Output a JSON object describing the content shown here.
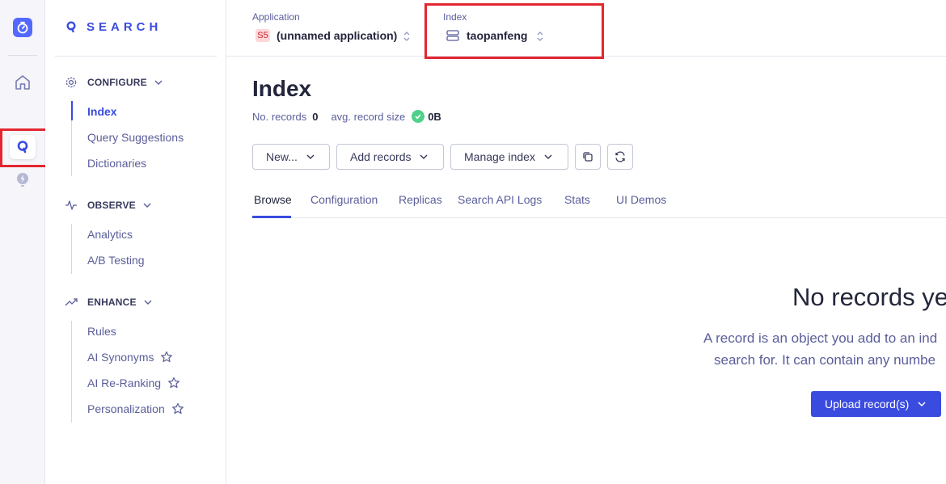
{
  "brand": {
    "name": "SEARCH"
  },
  "sidebar": {
    "sections": [
      {
        "label": "CONFIGURE",
        "items": [
          {
            "label": "Index",
            "active": true,
            "star": false
          },
          {
            "label": "Query Suggestions",
            "active": false,
            "star": false
          },
          {
            "label": "Dictionaries",
            "active": false,
            "star": false
          }
        ]
      },
      {
        "label": "OBSERVE",
        "items": [
          {
            "label": "Analytics",
            "star": false
          },
          {
            "label": "A/B Testing",
            "star": false
          }
        ]
      },
      {
        "label": "ENHANCE",
        "items": [
          {
            "label": "Rules",
            "star": false
          },
          {
            "label": "AI Synonyms",
            "star": true
          },
          {
            "label": "AI Re-Ranking",
            "star": true
          },
          {
            "label": "Personalization",
            "star": true
          }
        ]
      }
    ]
  },
  "topbar": {
    "application": {
      "label": "Application",
      "badge": "S5",
      "value": "(unnamed application)"
    },
    "index": {
      "label": "Index",
      "value": "taopanfeng"
    }
  },
  "page": {
    "title": "Index",
    "records_label": "No. records",
    "records_value": "0",
    "avg_label": "avg. record size",
    "avg_value": "0B"
  },
  "toolbar": {
    "new_label": "New...",
    "add_records_label": "Add records",
    "manage_index_label": "Manage index"
  },
  "tabs": [
    "Browse",
    "Configuration",
    "Replicas",
    "Search API Logs",
    "Stats",
    "UI Demos"
  ],
  "active_tab": "Browse",
  "empty_state": {
    "title": "No records ye",
    "line1": "A record is an object you add to an ind",
    "line2": "search for. It can contain any numbe",
    "upload_label": "Upload record(s)"
  },
  "colors": {
    "accent": "#3a4be0",
    "highlight": "#e3262f",
    "success": "#4fd18b",
    "logo": "#5468ff"
  }
}
